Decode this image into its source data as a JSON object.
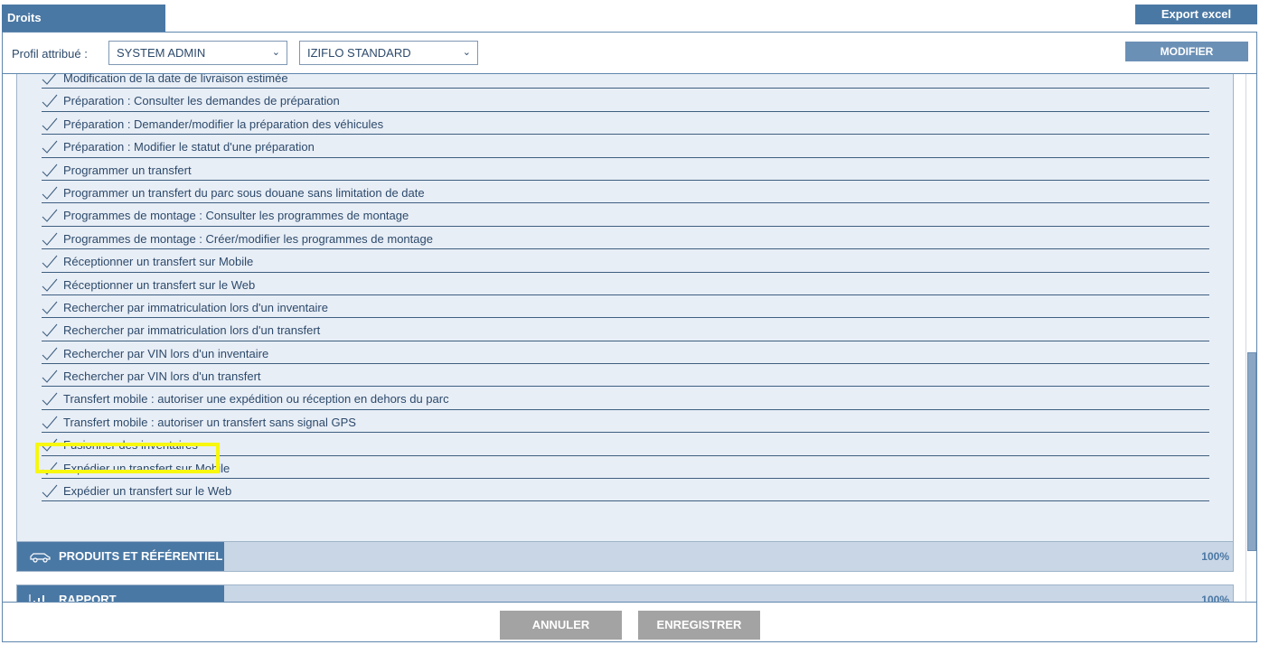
{
  "header": {
    "tab_title": "Droits",
    "export_label": "Export excel"
  },
  "profile": {
    "label": "Profil attribué :",
    "profile_value": "SYSTEM ADMIN",
    "template_value": "IZIFLO STANDARD",
    "modify_label": "MODIFIER"
  },
  "rights": [
    {
      "label": "Modification de la date de livraison estimée"
    },
    {
      "label": "Préparation : Consulter les demandes de préparation"
    },
    {
      "label": "Préparation : Demander/modifier la préparation des véhicules"
    },
    {
      "label": "Préparation : Modifier le statut d'une préparation"
    },
    {
      "label": "Programmer un transfert"
    },
    {
      "label": "Programmer un transfert du parc sous douane sans limitation de date"
    },
    {
      "label": "Programmes de montage : Consulter les programmes de montage"
    },
    {
      "label": "Programmes de montage : Créer/modifier les programmes de montage"
    },
    {
      "label": "Réceptionner un transfert sur Mobile"
    },
    {
      "label": "Réceptionner un transfert sur le Web"
    },
    {
      "label": "Rechercher par immatriculation lors d'un inventaire"
    },
    {
      "label": "Rechercher par immatriculation lors d'un transfert"
    },
    {
      "label": "Rechercher par VIN lors d'un inventaire"
    },
    {
      "label": "Rechercher par VIN lors d'un transfert"
    },
    {
      "label": "Transfert mobile : autoriser une expédition ou réception en dehors du parc"
    },
    {
      "label": "Transfert mobile : autoriser un transfert sans signal GPS"
    },
    {
      "label": "Fusionner des inventaires"
    },
    {
      "label": "Expédier un transfert sur Mobile"
    },
    {
      "label": "Expédier un transfert sur le Web"
    }
  ],
  "sections": [
    {
      "title": "PRODUITS ET RÉFÉRENTIEL",
      "percent": "100%",
      "icon": "car-icon"
    },
    {
      "title": "RAPPORT",
      "percent": "100%",
      "icon": "bar-chart-icon"
    }
  ],
  "footer": {
    "cancel_label": "ANNULER",
    "save_label": "ENREGISTRER"
  },
  "colors": {
    "primary": "#4a78a4",
    "highlight": "#f7f70f",
    "button_gray": "#a3a3a3"
  }
}
